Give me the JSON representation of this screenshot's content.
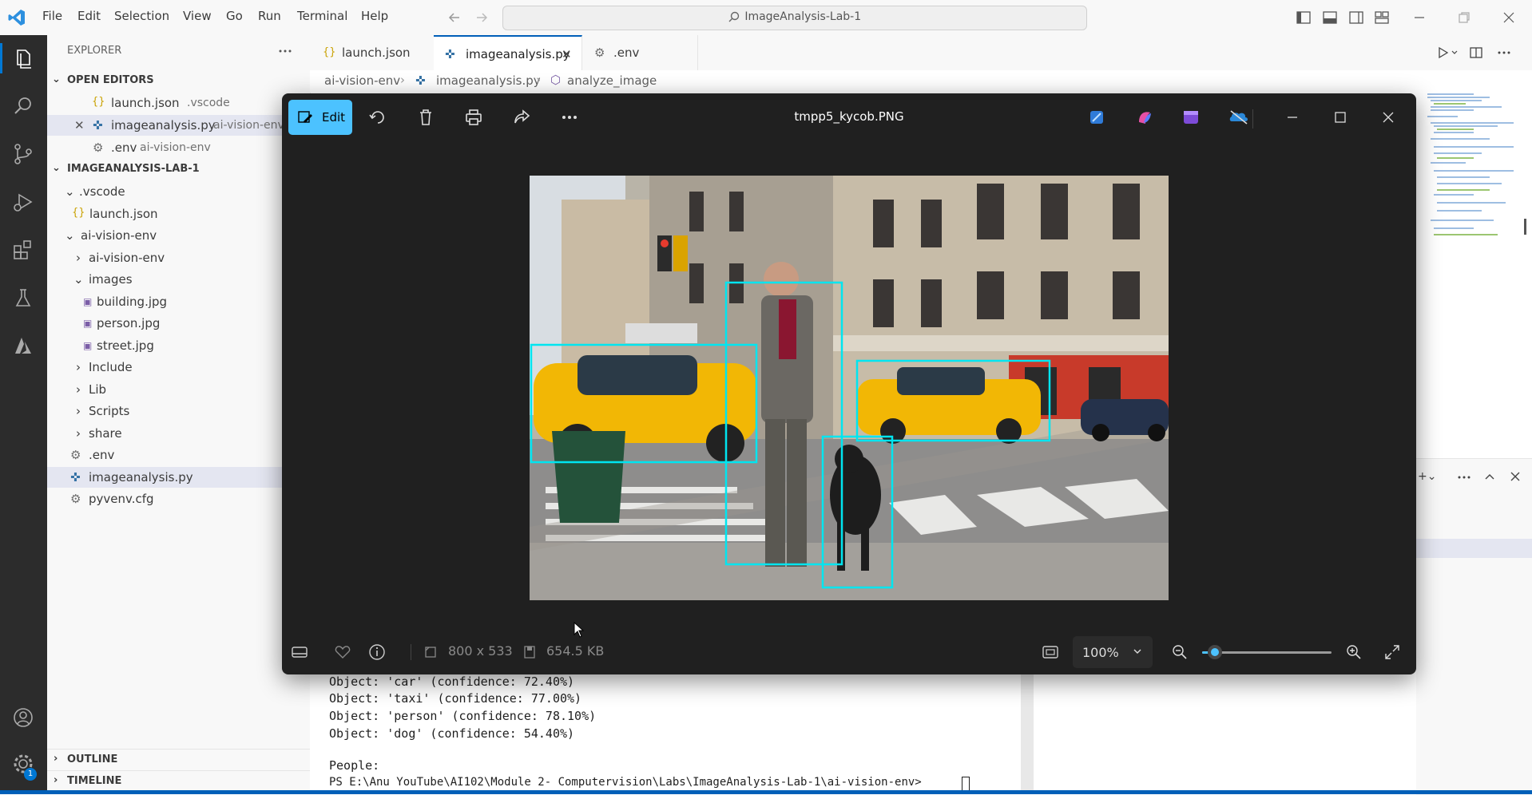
{
  "menu": [
    "File",
    "Edit",
    "Selection",
    "View",
    "Go",
    "Run",
    "Terminal",
    "Help"
  ],
  "command_center": "ImageAnalysis-Lab-1",
  "explorer": {
    "title": "EXPLORER",
    "open_editors_header": "OPEN EDITORS",
    "open_editors": [
      {
        "name": "launch.json",
        "path": ".vscode"
      },
      {
        "name": "imageanalysis.py",
        "path": "ai-vision-env"
      },
      {
        "name": ".env",
        "path": "ai-vision-env"
      }
    ],
    "workspace_header": "IMAGEANALYSIS-LAB-1",
    "tree": [
      ".vscode",
      "launch.json",
      "ai-vision-env",
      "ai-vision-env",
      "images",
      "building.jpg",
      "person.jpg",
      "street.jpg",
      "Include",
      "Lib",
      "Scripts",
      "share",
      ".env",
      "imageanalysis.py",
      "pyvenv.cfg"
    ],
    "outline": "OUTLINE",
    "timeline": "TIMELINE",
    "settings_badge": "1"
  },
  "tabs": [
    "launch.json",
    "imageanalysis.py",
    ".env"
  ],
  "breadcrumb": [
    "ai-vision-env",
    "imageanalysis.py",
    "analyze_image"
  ],
  "viewer": {
    "edit_label": "Edit",
    "file_name": "tmpp5_kycob.PNG",
    "dimensions": "800 x 533",
    "file_size": "654.5 KB",
    "zoom": "100%",
    "zoom_slider_fraction": 0.1
  },
  "photo": {
    "detections": [
      "taxi",
      "car",
      "person",
      "dog"
    ]
  },
  "terminal": {
    "lines": [
      "Object: 'car' (confidence: 72.40%)",
      "Object: 'taxi' (confidence: 77.00%)",
      "Object: 'person' (confidence: 78.10%)",
      "Object: 'dog' (confidence: 54.40%)",
      "",
      "People:",
      "PS E:\\Anu YouTube\\AI102\\Module 2- Computervision\\Labs\\ImageAnalysis-Lab-1\\ai-vision-env>"
    ]
  },
  "colors": {
    "accent": "#4cc2ff",
    "box": "#00e5f0",
    "vscode_blue": "#005fb8"
  }
}
